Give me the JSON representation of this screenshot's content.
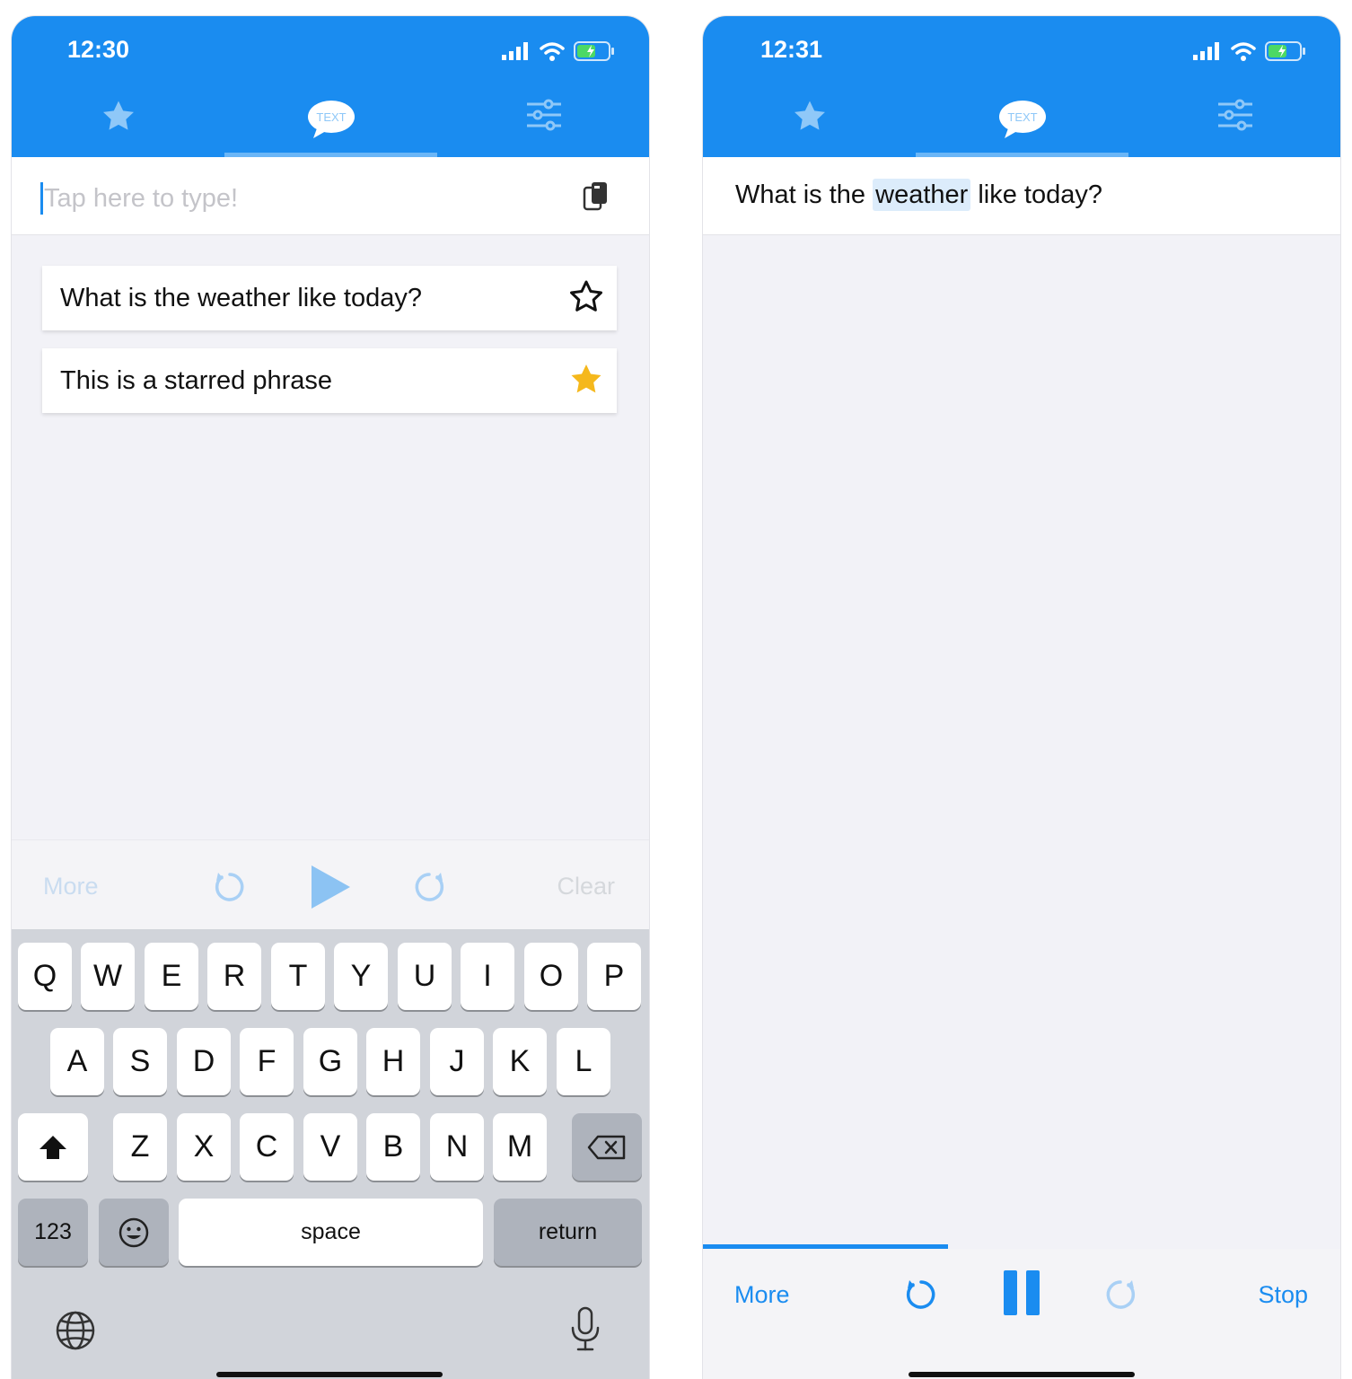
{
  "left": {
    "status": {
      "time": "12:30"
    },
    "tabs": {
      "center_label": "TEXT"
    },
    "input": {
      "placeholder": "Tap here to type!"
    },
    "phrases": [
      {
        "text": "What is the weather like today?",
        "starred": false
      },
      {
        "text": "This is a starred phrase",
        "starred": true
      }
    ],
    "controls": {
      "more": "More",
      "clear": "Clear"
    },
    "keyboard": {
      "row1": [
        "Q",
        "W",
        "E",
        "R",
        "T",
        "Y",
        "U",
        "I",
        "O",
        "P"
      ],
      "row2": [
        "A",
        "S",
        "D",
        "F",
        "G",
        "H",
        "J",
        "K",
        "L"
      ],
      "row3": [
        "Z",
        "X",
        "C",
        "V",
        "B",
        "N",
        "M"
      ],
      "numbers": "123",
      "space": "space",
      "return": "return"
    }
  },
  "right": {
    "status": {
      "time": "12:31"
    },
    "tabs": {
      "center_label": "TEXT"
    },
    "reading": {
      "before": "What is the ",
      "highlight": "weather",
      "after": " like today?"
    },
    "controls": {
      "more": "More",
      "stop": "Stop"
    },
    "progress": 0.385
  },
  "colors": {
    "accent": "#1a8cf0",
    "accent_light": "#6bb6f7",
    "star_gold": "#f5b81c",
    "highlight": "#dcecfb"
  },
  "icons": [
    "star-icon",
    "text-bubble-icon",
    "sliders-icon",
    "paste-icon",
    "rewind-icon",
    "play-icon",
    "forward-icon",
    "pause-icon",
    "shift-icon",
    "delete-icon",
    "emoji-icon",
    "globe-icon",
    "microphone-icon",
    "signal-icon",
    "wifi-icon",
    "battery-icon"
  ]
}
